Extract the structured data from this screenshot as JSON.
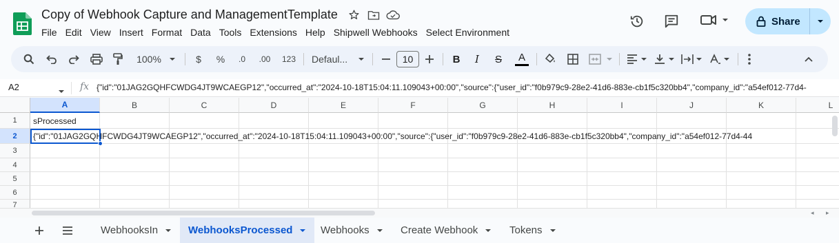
{
  "doc": {
    "title": "Copy of Webhook Capture and ManagementTemplate",
    "menu": [
      "File",
      "Edit",
      "View",
      "Insert",
      "Format",
      "Data",
      "Tools",
      "Extensions",
      "Help",
      "Shipwell Webhooks",
      "Select Environment"
    ]
  },
  "header": {
    "share_label": "Share"
  },
  "toolbar": {
    "zoom": "100%",
    "currency": "$",
    "percent": "%",
    "decrease_decimal": ".0",
    "increase_decimal": ".00",
    "number_format": "123",
    "font": "Defaul...",
    "font_size": "10"
  },
  "formula_bar": {
    "name_box": "A2",
    "fx": "fx",
    "formula": "{\"id\":\"01JAG2GQHFCWDG4JT9WCAEGP12\",\"occurred_at\":\"2024-10-18T15:04:11.109043+00:00\",\"source\":{\"user_id\":\"f0b979c9-28e2-41d6-883e-cb1f5c320bb4\",\"company_id\":\"a54ef012-77d4-"
  },
  "grid": {
    "columns": [
      "A",
      "B",
      "C",
      "D",
      "E",
      "F",
      "G",
      "H",
      "I",
      "J",
      "K",
      "L"
    ],
    "rows": [
      "1",
      "2",
      "3",
      "4",
      "5",
      "6",
      "7"
    ],
    "cells": {
      "A1": "sProcessed",
      "A2": "{\"id\":\"01JAG2GQHFCWDG4JT9WCAEGP12\",\"occurred_at\":\"2024-10-18T15:04:11.109043+00:00\",\"source\":{\"user_id\":\"f0b979c9-28e2-41d6-883e-cb1f5c320bb4\",\"company_id\":\"a54ef012-77d4-44"
    },
    "selected_cell": "A2"
  },
  "sheets": {
    "tabs": [
      {
        "label": "WebhooksIn",
        "active": false
      },
      {
        "label": "WebhooksProcessed",
        "active": true
      },
      {
        "label": "Webhooks",
        "active": false
      },
      {
        "label": "Create Webhook",
        "active": false
      },
      {
        "label": "Tokens",
        "active": false
      }
    ]
  },
  "colors": {
    "accent": "#0b57d0",
    "share_bg": "#c2e7ff",
    "toolbar_bg": "#edf2fa",
    "sheets_green": "#0f9d58"
  }
}
